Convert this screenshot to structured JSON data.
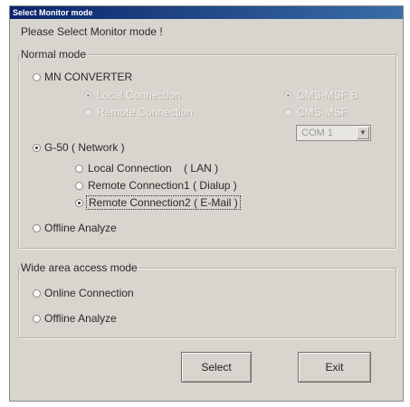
{
  "window": {
    "title": "Select Monitor mode"
  },
  "prompt": "Please Select Monitor mode !",
  "normal_mode": {
    "label": "Normal mode",
    "mn_converter": {
      "label": "MN CONVERTER",
      "local": "Local Connection",
      "remote": "Remote Connection",
      "option_a": "CMS-MSF B",
      "option_b": "CMS-MSF",
      "com_port": "COM 1"
    },
    "g50": {
      "label": "G-50 ( Network )",
      "local": "Local Connection    ( LAN )",
      "remote1": "Remote Connection1 ( Dialup )",
      "remote2": "Remote Connection2 ( E-Mail )"
    },
    "offline": "Offline Analyze"
  },
  "wide_area": {
    "label": "Wide area access mode",
    "online": "Online Connection",
    "offline": "Offline Analyze"
  },
  "buttons": {
    "select": "Select",
    "exit": "Exit"
  }
}
